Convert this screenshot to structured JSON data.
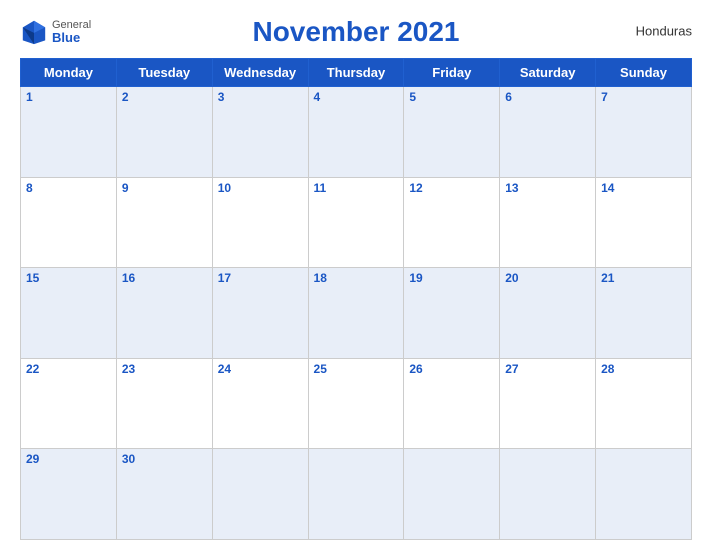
{
  "header": {
    "logo_general": "General",
    "logo_blue": "Blue",
    "title": "November 2021",
    "country": "Honduras"
  },
  "weekdays": [
    "Monday",
    "Tuesday",
    "Wednesday",
    "Thursday",
    "Friday",
    "Saturday",
    "Sunday"
  ],
  "weeks": [
    [
      1,
      2,
      3,
      4,
      5,
      6,
      7
    ],
    [
      8,
      9,
      10,
      11,
      12,
      13,
      14
    ],
    [
      15,
      16,
      17,
      18,
      19,
      20,
      21
    ],
    [
      22,
      23,
      24,
      25,
      26,
      27,
      28
    ],
    [
      29,
      30,
      null,
      null,
      null,
      null,
      null
    ]
  ]
}
